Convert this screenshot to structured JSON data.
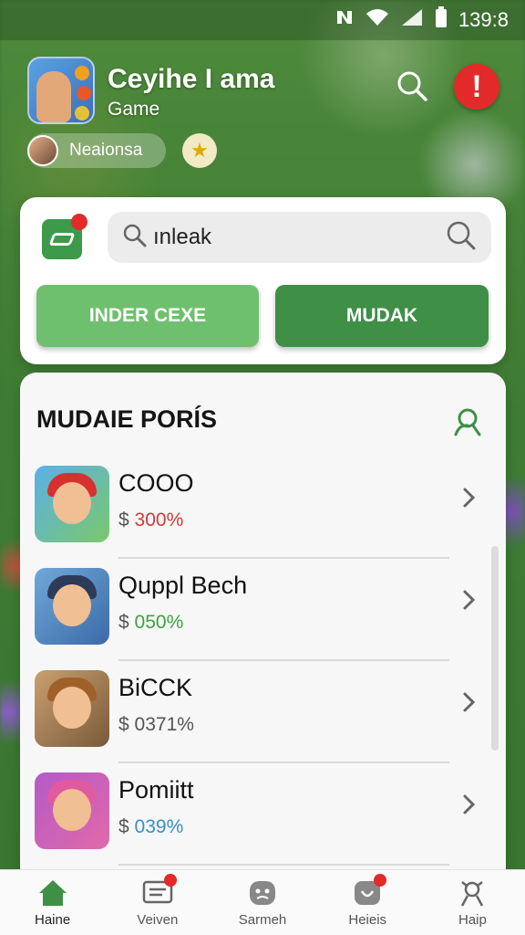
{
  "status_bar": {
    "time": "139:8"
  },
  "header": {
    "app_title": "Ceyihe I ama",
    "app_subtitle": "Game",
    "user_name": "Neaionsa",
    "alert_symbol": "!"
  },
  "top_card": {
    "search_value": "ınleak",
    "button_left": "INDER CEXE",
    "button_right": "MUDAK"
  },
  "list": {
    "title": "MUDAIE PORÍS",
    "items": [
      {
        "name": "COOO",
        "currency": "$",
        "price": "300%",
        "price_color": "#d23a3a"
      },
      {
        "name": "Quppl Bech",
        "currency": "$",
        "price": "050%",
        "price_color": "#3aa43a"
      },
      {
        "name": "BiCCK",
        "currency": "$",
        "price": "0371%",
        "price_color": "#555555"
      },
      {
        "name": "Pomiitt",
        "currency": "$",
        "price": "039%",
        "price_color": "#3a8fc4"
      }
    ]
  },
  "bottom_nav": [
    {
      "label": "Haine",
      "icon": "home-icon",
      "active": true
    },
    {
      "label": "Veiven",
      "icon": "message-icon",
      "badge": true
    },
    {
      "label": "Sarmeh",
      "icon": "face-icon"
    },
    {
      "label": "Heieis",
      "icon": "heart-chat-icon",
      "badge": true
    },
    {
      "label": "Haip",
      "icon": "person-icon"
    }
  ],
  "colors": {
    "accent_green": "#3f8f47",
    "light_green": "#6ec06e",
    "alert_red": "#e32a2a"
  }
}
